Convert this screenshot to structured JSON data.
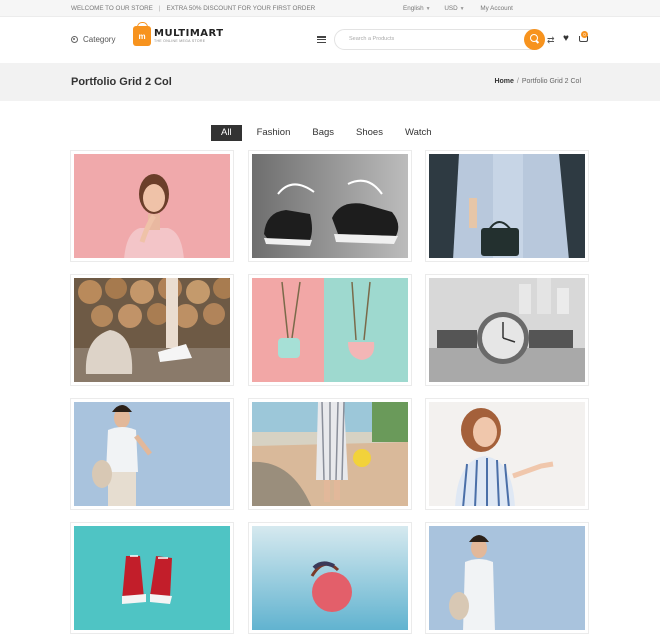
{
  "topbar": {
    "welcome": "WELCOME TO OUR STORE",
    "promo": "EXTRA 50% DISCOUNT FOR YOUR FIRST ORDER",
    "language": "English",
    "currency": "USD",
    "account": "My Account"
  },
  "header": {
    "category_label": "Category",
    "logo_name": "MULTIMART",
    "logo_tagline": "THE ONLINE MEGA STORE",
    "search_placeholder": "Search a Products",
    "cart_count": "0"
  },
  "page": {
    "title": "Portfolio Grid 2 Col",
    "breadcrumb_home": "Home",
    "breadcrumb_current": "Portfolio Grid 2 Col"
  },
  "filters": [
    "All",
    "Fashion",
    "Bags",
    "Shoes",
    "Watch"
  ],
  "active_filter": "All",
  "portfolio_items": [
    {
      "subject": "woman-pink-top",
      "bg": "#f0a9ab"
    },
    {
      "subject": "sneakers",
      "bg": "#8c8c8c"
    },
    {
      "subject": "dress-handbag",
      "bg": "#2e3a42"
    },
    {
      "subject": "backpack-logs",
      "bg": "#6e5a45"
    },
    {
      "subject": "pendant-necklaces",
      "bg": "#9ed9cf"
    },
    {
      "subject": "wristwatch",
      "bg": "#c9c9c9"
    },
    {
      "subject": "woman-blue-wall",
      "bg": "#a9c3dd"
    },
    {
      "subject": "striped-dress-walk",
      "bg": "#d6c3a6"
    },
    {
      "subject": "woman-striped-shirt",
      "bg": "#f3f1ef"
    },
    {
      "subject": "red-sneakers",
      "bg": "#4fc4c4"
    },
    {
      "subject": "round-bag-sea",
      "bg": "#9bd0e3"
    },
    {
      "subject": "woman-blue-wall-2",
      "bg": "#a9c3dd"
    }
  ],
  "colors": {
    "accent": "#f7931e",
    "dark": "#333333"
  }
}
